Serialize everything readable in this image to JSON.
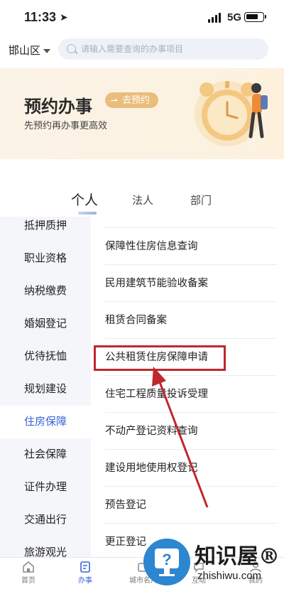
{
  "status_bar": {
    "time": "11:33",
    "network": "5G"
  },
  "header": {
    "region": "邯山区",
    "search_placeholder": "请输入需要查询的办事项目"
  },
  "banner": {
    "title": "预约办事",
    "button": "去预约",
    "subtitle": "先预约再办事更高效"
  },
  "tabs": [
    {
      "label": "个人",
      "active": true
    },
    {
      "label": "法人",
      "active": false
    },
    {
      "label": "部门",
      "active": false
    }
  ],
  "sidebar": {
    "items": [
      {
        "label": "抵押质押"
      },
      {
        "label": "职业资格"
      },
      {
        "label": "纳税缴费"
      },
      {
        "label": "婚姻登记"
      },
      {
        "label": "优待抚恤"
      },
      {
        "label": "规划建设"
      },
      {
        "label": "住房保障",
        "active": true
      },
      {
        "label": "社会保障"
      },
      {
        "label": "证件办理"
      },
      {
        "label": "交通出行"
      },
      {
        "label": "旅游观光"
      }
    ]
  },
  "services": {
    "items": [
      {
        "label": "保障性住房信息查询"
      },
      {
        "label": "民用建筑节能验收备案"
      },
      {
        "label": "租赁合同备案"
      },
      {
        "label": "公共租赁住房保障申请",
        "highlighted": true
      },
      {
        "label": "住宅工程质量投诉受理"
      },
      {
        "label": "不动产登记资料查询"
      },
      {
        "label": "建设用地使用权登记"
      },
      {
        "label": "预告登记"
      },
      {
        "label": "更正登记"
      }
    ]
  },
  "bottom_nav": [
    {
      "label": "首页",
      "icon": "home-icon"
    },
    {
      "label": "办事",
      "icon": "service-icon",
      "active": true
    },
    {
      "label": "城市名片",
      "icon": "city-card-icon"
    },
    {
      "label": "互动",
      "icon": "interact-icon"
    },
    {
      "label": "我的",
      "icon": "profile-icon"
    }
  ],
  "watermark": {
    "brand": "知识屋®",
    "url": "zhishiwu.com"
  },
  "colors": {
    "accent": "#3a63d9",
    "highlight_border": "#c0272d",
    "banner_button": "#e9bd7c"
  }
}
